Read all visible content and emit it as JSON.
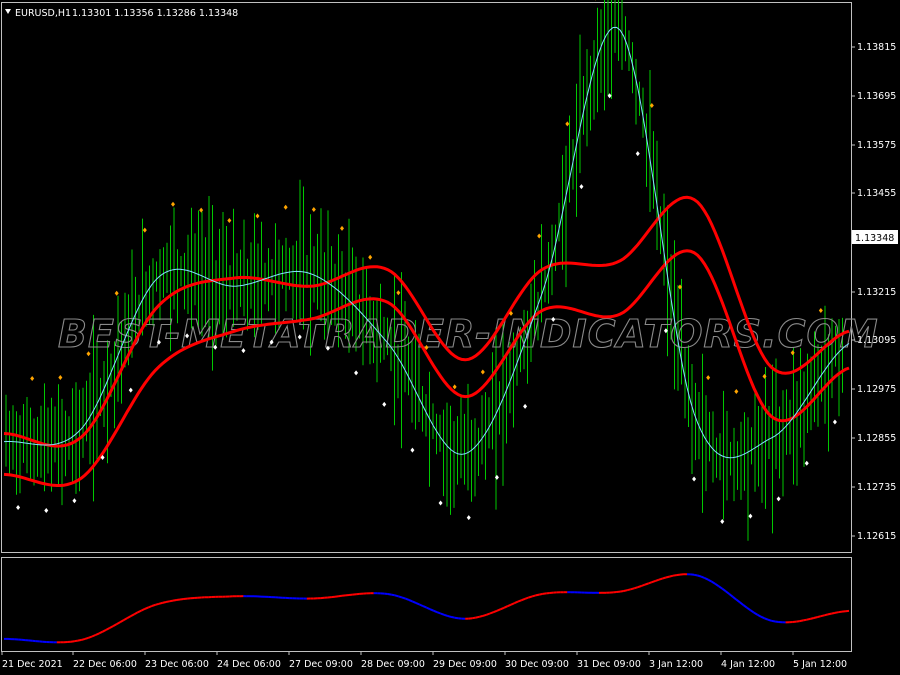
{
  "header": {
    "symbol": "EURUSD,H1",
    "ohlc": "1.13301 1.13356 1.13286 1.13348"
  },
  "watermark": "BEST-METATRADER-INDICATORS.COM",
  "current_price": "1.13348",
  "colors": {
    "background": "#000000",
    "candle": "#00c800",
    "signal_line": "#80e0ff",
    "bands": "#ff0000",
    "dot_up": "#ffa500",
    "dot_down": "#ffffff",
    "osc_up": "#ff0000",
    "osc_down": "#0000ff",
    "frame": "#c0c0c0"
  },
  "price_axis": [
    "1.13815",
    "1.13695",
    "1.13575",
    "1.13455",
    "1.13215",
    "1.13095",
    "1.12975",
    "1.12855",
    "1.12735",
    "1.12615"
  ],
  "time_axis": [
    "21 Dec 2021",
    "22 Dec 06:00",
    "23 Dec 06:00",
    "24 Dec 06:00",
    "27 Dec 09:00",
    "28 Dec 09:00",
    "29 Dec 09:00",
    "30 Dec 09:00",
    "31 Dec 09:00",
    "3 Jan 12:00",
    "4 Jan 12:00",
    "5 Jan 12:00"
  ],
  "chart_data": {
    "type": "line",
    "symbol": "EURUSD",
    "timeframe": "H1",
    "x": [
      "21 Dec 2021",
      "22 Dec 06:00",
      "23 Dec 06:00",
      "24 Dec 06:00",
      "27 Dec 09:00",
      "28 Dec 09:00",
      "29 Dec 09:00",
      "30 Dec 09:00",
      "31 Dec 09:00",
      "3 Jan 12:00",
      "4 Jan 12:00",
      "5 Jan 12:00"
    ],
    "ylim": [
      1.1258,
      1.139
    ],
    "series": [
      {
        "name": "",
        "values": [
          1.1284,
          1.1287,
          1.1324,
          1.1322,
          1.1325,
          1.1308,
          1.1281,
          1.132,
          1.1385,
          1.129,
          1.1285,
          1.1308
        ]
      },
      {
        "values": [
          1.1286,
          1.1285,
          1.1317,
          1.1324,
          1.1322,
          1.1326,
          1.1304,
          1.1326,
          1.1328,
          1.1343,
          1.1302,
          1.1311
        ]
      },
      {
        "values": [
          1.1276,
          1.1275,
          1.1302,
          1.1311,
          1.1314,
          1.1318,
          1.1295,
          1.1316,
          1.1315,
          1.133,
          1.129,
          1.1302
        ]
      }
    ],
    "grid": false
  }
}
